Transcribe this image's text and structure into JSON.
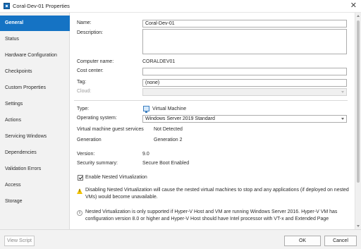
{
  "window": {
    "title": "Coral-Dev-01 Properties",
    "close_glyph": "✕"
  },
  "sidebar": {
    "items": [
      {
        "label": "General",
        "active": true
      },
      {
        "label": "Status"
      },
      {
        "label": "Hardware Configuration"
      },
      {
        "label": "Checkpoints"
      },
      {
        "label": "Custom Properties"
      },
      {
        "label": "Settings"
      },
      {
        "label": "Actions"
      },
      {
        "label": "Servicing Windows"
      },
      {
        "label": "Dependencies"
      },
      {
        "label": "Validation Errors"
      },
      {
        "label": "Access"
      },
      {
        "label": "Storage"
      }
    ]
  },
  "general": {
    "name_label": "Name:",
    "name_value": "Coral-Dev-01",
    "description_label": "Description:",
    "description_value": "",
    "computer_name_label": "Computer name:",
    "computer_name_value": "CORALDEV01",
    "cost_center_label": "Cost center:",
    "cost_center_value": "",
    "tag_label": "Tag:",
    "tag_value": "(none)",
    "cloud_label": "Cloud:",
    "cloud_value": "",
    "type_label": "Type:",
    "type_value": "Virtual Machine",
    "os_label": "Operating system:",
    "os_value": "Windows Server 2019 Standard",
    "guest_services_label": "Virtual machine guest services",
    "guest_services_value": "Not Detected",
    "generation_label": "Generation",
    "generation_value": "Generation 2",
    "version_label": "Version:",
    "version_value": "9.0",
    "security_label": "Security summary:",
    "security_value": "Secure Boot Enabled",
    "nested_checkbox_label": "Enable Nested Virtualization",
    "nested_checked": true,
    "warning_text": "Disabling Nested Virtualization will cause the nested virtual machines to stop and any applications (if deployed on nested VMs) would become unavailable.",
    "info_text": "Nested Virtualization is only supported if Hyper-V Host and VM are running Windows Server 2016. Hyper-V VM has configuration version 8.0 or higher and Hyper-V Host should have Intel processor with VT-x and Extended Page"
  },
  "footer": {
    "view_script_label": "View Script",
    "ok_label": "OK",
    "cancel_label": "Cancel"
  },
  "colors": {
    "accent": "#1573c4",
    "warning": "#f2c200"
  },
  "icons": {
    "app": "vm-properties-icon",
    "type": "virtual-machine-icon",
    "warning": "warning-icon",
    "info": "info-icon"
  }
}
